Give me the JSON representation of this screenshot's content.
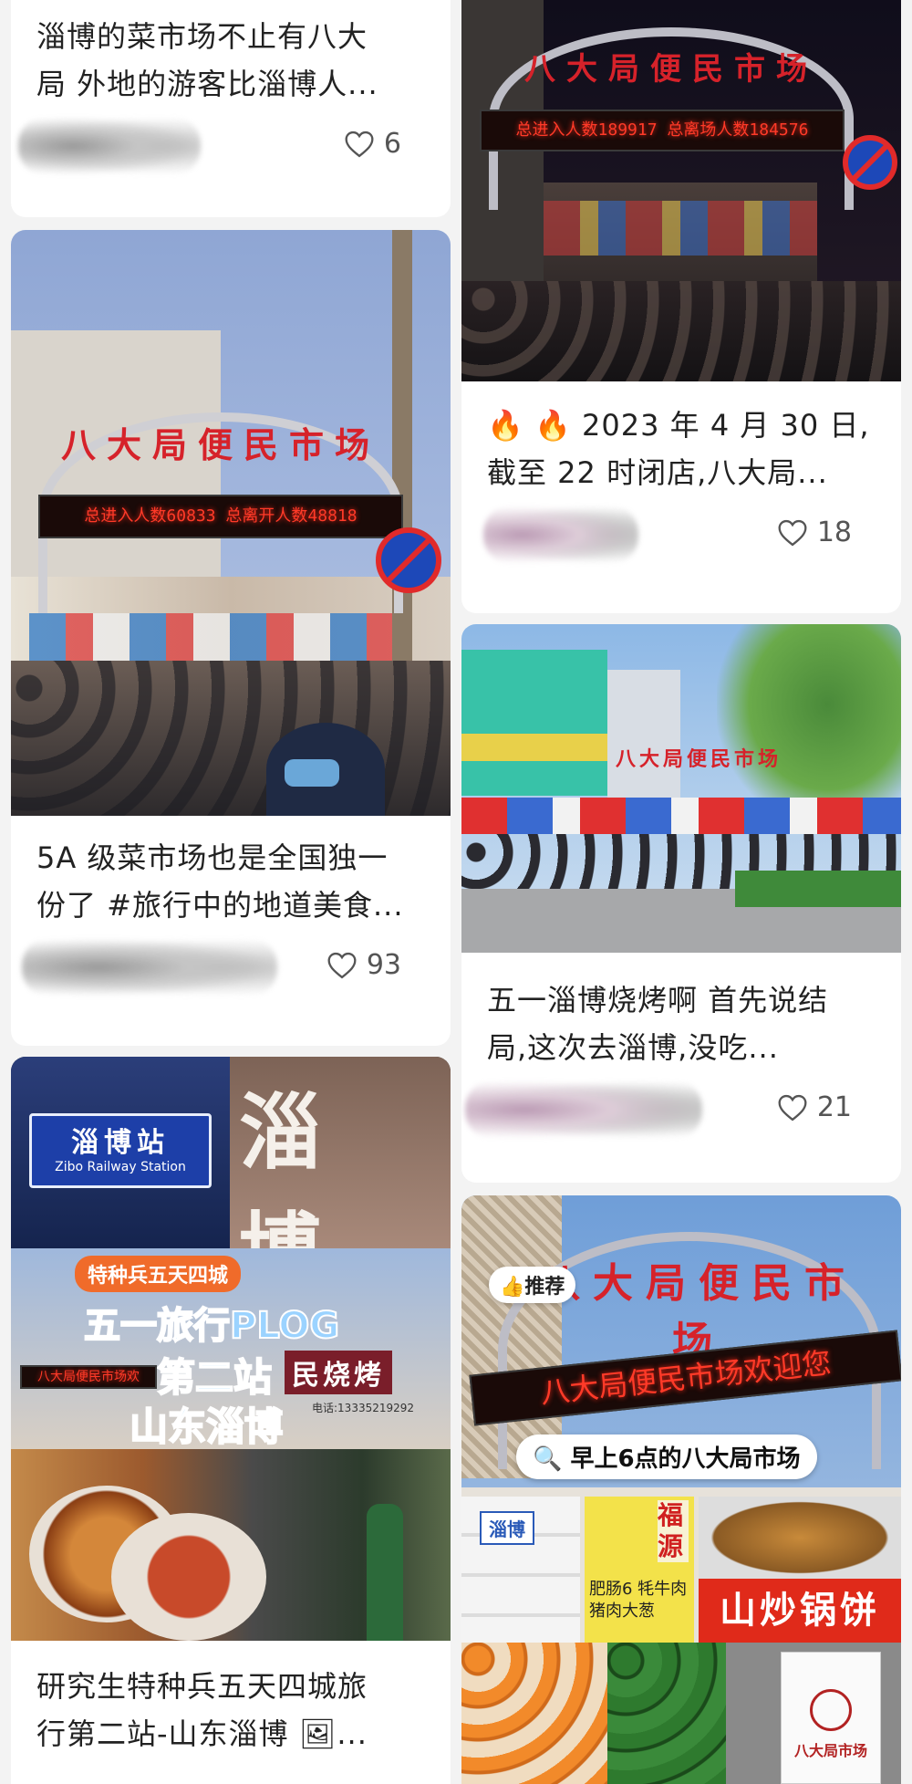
{
  "cards": [
    {
      "title": "淄博的菜市场不止有八大\n局 外地的游客比淄博人...",
      "likes": "6"
    },
    {
      "title": "5A 级菜市场也是全国独一\n份了 #旅行中的地道美食...",
      "likes": "93",
      "image": {
        "arch_text": "八大局便民市场",
        "led_text": "总进入人数60833  总离开人数48818"
      }
    },
    {
      "title": "研究生特种兵五天四城旅\n行第二站-山东淄博 🖼...",
      "image": {
        "station_sign": "淄博站",
        "station_sign_en": "Zibo Railway Station",
        "big_chars": "淄 博",
        "badge": "特种兵五天四城",
        "line1": "五一旅行PLOG",
        "line2": "第二站",
        "line3": "山东淄博",
        "shop_sign": "民烧烤",
        "arch_text": "八大局便民市场欢",
        "phone": "电话:13335219292"
      }
    },
    {
      "title": "🔥 🔥 2023 年 4 月 30 日,\n截至 22 时闭店,八大局...",
      "likes": "18",
      "image": {
        "arch_text": "八大局便民市场",
        "led_text": "总进入人数189917 总离场人数184576"
      }
    },
    {
      "title": "五一淄博烧烤啊 首先说结\n局,这次去淄博,没吃...",
      "likes": "21",
      "image": {
        "arch_text": "八大局便民市场"
      }
    },
    {
      "title": "",
      "image": {
        "arch_text": "八大局便民市场",
        "led_text": "八大局便民市场欢迎您",
        "badge": "推荐",
        "search_caption": "早上6点的八大局市场",
        "stall_sign": "福源",
        "box_label": "淄博",
        "menu": "肥肠6 牦牛肉 猪肉大葱",
        "red_sign": "山炒锅饼",
        "bag_text": "八大局市场"
      }
    }
  ],
  "colors": {
    "like": "#555555",
    "led": "#ff3a28",
    "arch_text": "#d6222a",
    "background": "#f3f3f3"
  }
}
